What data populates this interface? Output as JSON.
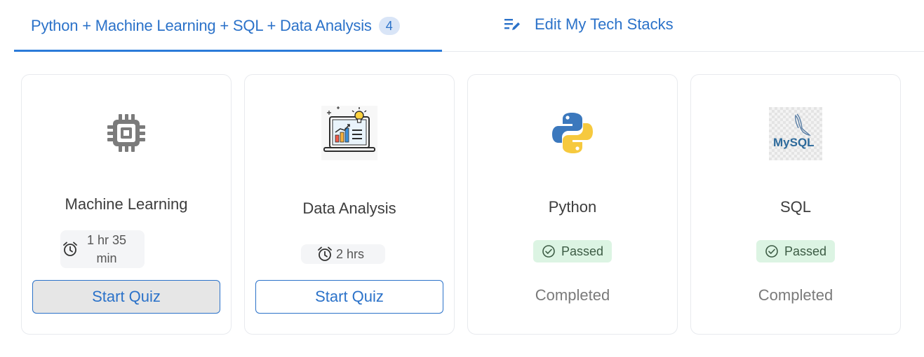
{
  "tabs": {
    "active_label": "Python + Machine Learning + SQL + Data Analysis",
    "active_count": "4",
    "edit_label": "Edit My Tech Stacks"
  },
  "colors": {
    "accent": "#2b72c9",
    "passed_bg": "#dcf4e3"
  },
  "cards": [
    {
      "icon": "chip-icon",
      "title": "Machine Learning",
      "duration_line1": "1 hr 35",
      "duration_line2": "min",
      "button": "Start Quiz"
    },
    {
      "icon": "data-analysis-laptop-icon",
      "title": "Data Analysis",
      "duration": "2 hrs",
      "button": "Start Quiz"
    },
    {
      "icon": "python-logo-icon",
      "title": "Python",
      "status": "Passed",
      "state": "Completed"
    },
    {
      "icon": "mysql-logo-icon",
      "title": "SQL",
      "status": "Passed",
      "state": "Completed",
      "logo_text": "MySQL"
    }
  ]
}
